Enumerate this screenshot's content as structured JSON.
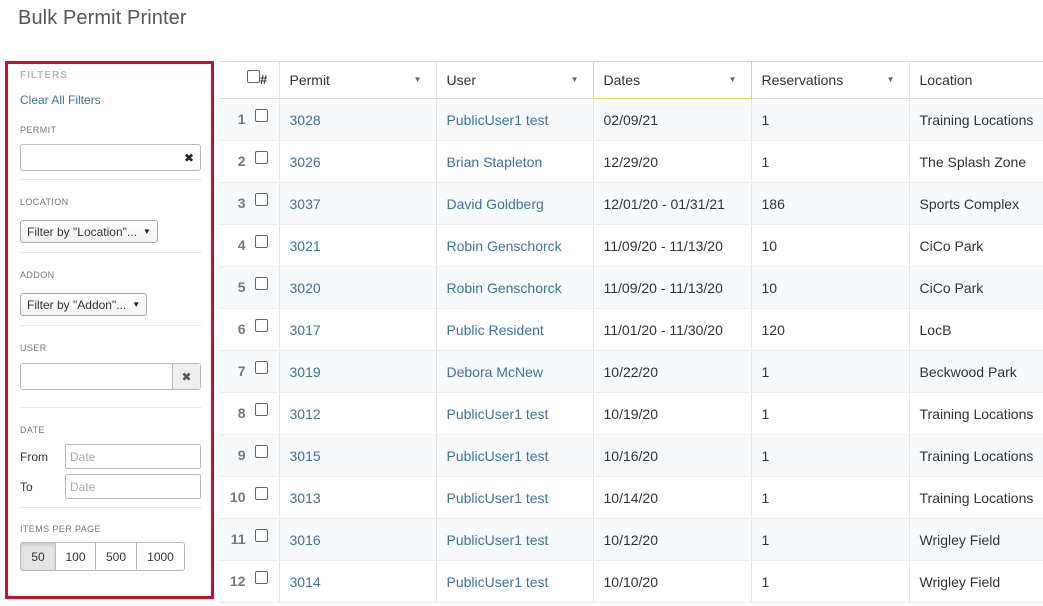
{
  "page": {
    "title": "Bulk Permit Printer"
  },
  "filters": {
    "heading": "FILTERS",
    "clear_all": "Clear All Filters",
    "permit_label": "PERMIT",
    "permit_value": "",
    "location_label": "LOCATION",
    "location_select": "Filter by \"Location\"...",
    "addon_label": "ADDON",
    "addon_select": "Filter by \"Addon\"...",
    "user_label": "USER",
    "user_value": "",
    "date_label": "DATE",
    "from_label": "From",
    "to_label": "To",
    "from_placeholder": "Date",
    "to_placeholder": "Date",
    "items_per_page_label": "ITEMS PER PAGE",
    "items_per_page_options": [
      "50",
      "100",
      "500",
      "1000"
    ],
    "items_per_page_selected": "50"
  },
  "table": {
    "hash_label": "#",
    "columns": [
      "Permit",
      "User",
      "Dates",
      "Reservations",
      "Location"
    ],
    "sorted_column": "Dates",
    "rows": [
      {
        "num": "1",
        "permit": "3028",
        "user": "PublicUser1 test",
        "dates": "02/09/21",
        "reservations": "1",
        "location": "Training Locations"
      },
      {
        "num": "2",
        "permit": "3026",
        "user": "Brian Stapleton",
        "dates": "12/29/20",
        "reservations": "1",
        "location": "The Splash Zone"
      },
      {
        "num": "3",
        "permit": "3037",
        "user": "David Goldberg",
        "dates": "12/01/20 - 01/31/21",
        "reservations": "186",
        "location": "Sports Complex"
      },
      {
        "num": "4",
        "permit": "3021",
        "user": "Robin Genschorck",
        "dates": "11/09/20 - 11/13/20",
        "reservations": "10",
        "location": "CiCo Park"
      },
      {
        "num": "5",
        "permit": "3020",
        "user": "Robin Genschorck",
        "dates": "11/09/20 - 11/13/20",
        "reservations": "10",
        "location": "CiCo Park"
      },
      {
        "num": "6",
        "permit": "3017",
        "user": "Public Resident",
        "dates": "11/01/20 - 11/30/20",
        "reservations": "120",
        "location": "LocB"
      },
      {
        "num": "7",
        "permit": "3019",
        "user": "Debora McNew",
        "dates": "10/22/20",
        "reservations": "1",
        "location": "Beckwood Park"
      },
      {
        "num": "8",
        "permit": "3012",
        "user": "PublicUser1 test",
        "dates": "10/19/20",
        "reservations": "1",
        "location": "Training Locations"
      },
      {
        "num": "9",
        "permit": "3015",
        "user": "PublicUser1 test",
        "dates": "10/16/20",
        "reservations": "1",
        "location": "Training Locations"
      },
      {
        "num": "10",
        "permit": "3013",
        "user": "PublicUser1 test",
        "dates": "10/14/20",
        "reservations": "1",
        "location": "Training Locations"
      },
      {
        "num": "11",
        "permit": "3016",
        "user": "PublicUser1 test",
        "dates": "10/12/20",
        "reservations": "1",
        "location": "Wrigley Field"
      },
      {
        "num": "12",
        "permit": "3014",
        "user": "PublicUser1 test",
        "dates": "10/10/20",
        "reservations": "1",
        "location": "Wrigley Field"
      }
    ]
  },
  "colors": {
    "accent_link": "#3a73a8",
    "highlight_border": "#c8102e",
    "sorted_header": "#f0d94f"
  }
}
